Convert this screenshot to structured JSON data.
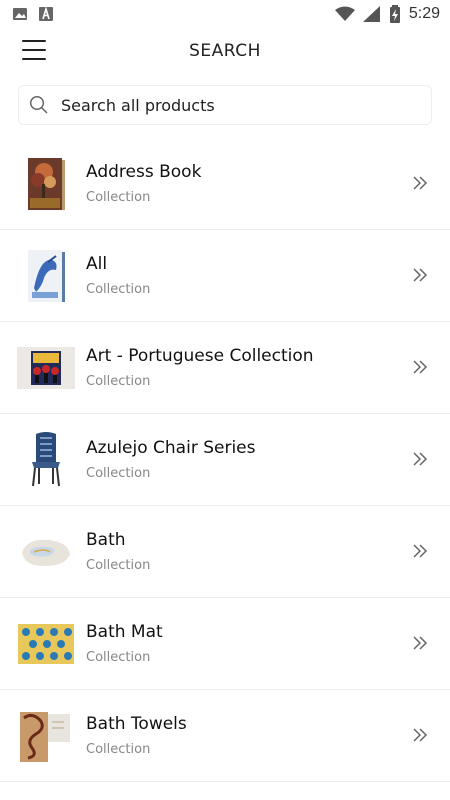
{
  "status_bar": {
    "time": "5:29",
    "left_icons": [
      "image-icon",
      "font-icon"
    ],
    "right_icons": [
      "wifi-icon",
      "signal-icon",
      "battery-icon"
    ]
  },
  "header": {
    "title": "SEARCH",
    "menu_icon": "hamburger-icon"
  },
  "search": {
    "placeholder": "Search all products",
    "icon": "search-icon"
  },
  "items": [
    {
      "title": "Address Book",
      "subtitle": "Collection",
      "thumb": "book-thumb"
    },
    {
      "title": "All",
      "subtitle": "Collection",
      "thumb": "book-thumb-blue"
    },
    {
      "title": "Art - Portuguese Collection",
      "subtitle": "Collection",
      "thumb": "art-thumb"
    },
    {
      "title": "Azulejo Chair Series",
      "subtitle": "Collection",
      "thumb": "chair-thumb"
    },
    {
      "title": "Bath",
      "subtitle": "Collection",
      "thumb": "towel-thumb"
    },
    {
      "title": "Bath Mat",
      "subtitle": "Collection",
      "thumb": "mat-thumb"
    },
    {
      "title": "Bath Towels",
      "subtitle": "Collection",
      "thumb": "towels-thumb"
    }
  ],
  "colors": {
    "text": "#111111",
    "subtitle": "#888888",
    "divider": "#ececec"
  }
}
